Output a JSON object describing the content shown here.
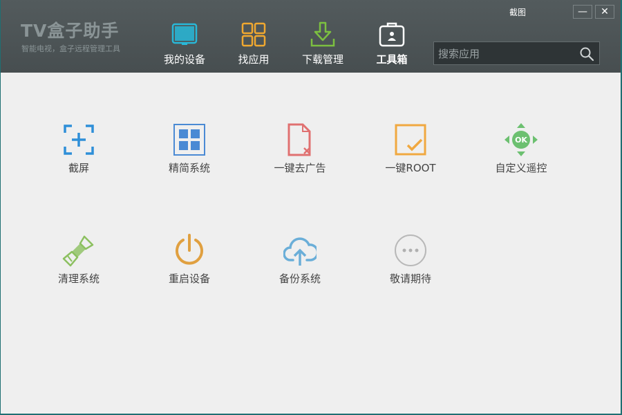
{
  "app": {
    "title": "TV盒子助手",
    "subtitle": "智能电视，盒子远程管理工具"
  },
  "nav": [
    {
      "label": "我的设备",
      "icon": "tv-icon",
      "active": false
    },
    {
      "label": "找应用",
      "icon": "apps-grid-icon",
      "active": false
    },
    {
      "label": "下载管理",
      "icon": "download-icon",
      "active": false
    },
    {
      "label": "工具箱",
      "icon": "toolbox-icon",
      "active": true
    }
  ],
  "window": {
    "screenshot_label": "截图",
    "minimize_label": "—",
    "close_label": "✕"
  },
  "search": {
    "placeholder": "搜索应用"
  },
  "tools": [
    {
      "label": "截屏",
      "icon": "screenshot-icon",
      "color": "#2f8fd8"
    },
    {
      "label": "精简系统",
      "icon": "slim-system-icon",
      "color": "#4a8ad4"
    },
    {
      "label": "一键去广告",
      "icon": "remove-ads-icon",
      "color": "#e07070"
    },
    {
      "label": "一键ROOT",
      "icon": "root-icon",
      "color": "#f0a840"
    },
    {
      "label": "自定义遥控",
      "icon": "remote-icon",
      "color": "#6cc070"
    },
    {
      "label": "清理系统",
      "icon": "clean-brush-icon",
      "color": "#8cc060"
    },
    {
      "label": "重启设备",
      "icon": "power-icon",
      "color": "#e0a040"
    },
    {
      "label": "备份系统",
      "icon": "cloud-upload-icon",
      "color": "#6aaed8"
    },
    {
      "label": "敬请期待",
      "icon": "more-icon",
      "color": "#b0b0b0"
    }
  ]
}
